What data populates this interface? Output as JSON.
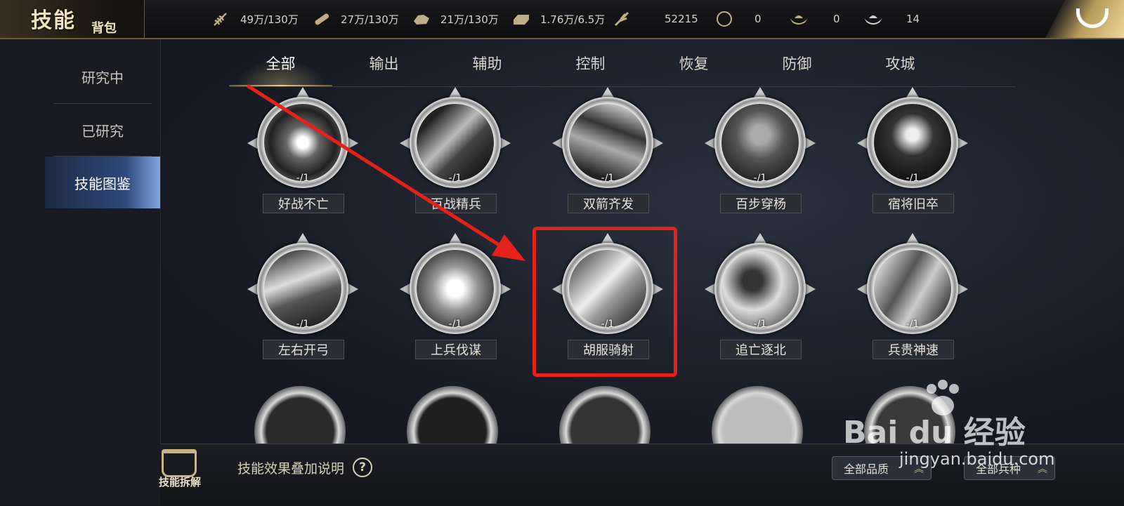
{
  "header": {
    "title_main": "技能",
    "title_sub": "背包",
    "resources": [
      {
        "icon": "wheat-icon",
        "value": "49万/130万"
      },
      {
        "icon": "wood-icon",
        "value": "27万/130万"
      },
      {
        "icon": "stone-icon",
        "value": "21万/130万"
      },
      {
        "icon": "iron-icon",
        "value": "1.76万/6.5万"
      },
      {
        "icon": "feather-icon",
        "value": "52215"
      },
      {
        "icon": "copper-coin-icon",
        "value": "0"
      },
      {
        "icon": "gold-ingot-icon",
        "value": "0"
      },
      {
        "icon": "silver-ingot-icon",
        "value": "14"
      }
    ]
  },
  "sidebar": {
    "items": [
      {
        "label": "研究中"
      },
      {
        "label": "已研究"
      },
      {
        "label": "技能图鉴"
      }
    ],
    "active": "技能图鉴"
  },
  "tabs": [
    "全部",
    "输出",
    "辅助",
    "控制",
    "恢复",
    "防御",
    "攻城"
  ],
  "active_tab": "全部",
  "skills": [
    {
      "name": "好战不亡",
      "count": "-/1"
    },
    {
      "name": "百战精兵",
      "count": "-/1"
    },
    {
      "name": "双箭齐发",
      "count": "-/1"
    },
    {
      "name": "百步穿杨",
      "count": "-/1"
    },
    {
      "name": "宿将旧卒",
      "count": "-/1"
    },
    {
      "name": "左右开弓",
      "count": "-/1"
    },
    {
      "name": "上兵伐谋",
      "count": "-/1"
    },
    {
      "name": "胡服骑射",
      "count": "-/1"
    },
    {
      "name": "追亡逐北",
      "count": "-/1"
    },
    {
      "name": "兵贵神速",
      "count": "-/1"
    }
  ],
  "bottom": {
    "decompose_label": "技能拆解",
    "effect_note": "技能效果叠加说明",
    "help": "?",
    "filter_quality": "全部品质",
    "filter_troop": "全部兵种"
  },
  "watermark": {
    "main": "Bai du 经验",
    "sub": "jingyan.baidu.com"
  },
  "colors": {
    "accent_gold": "#e8cf8a",
    "active_blue": "#2e4a7a",
    "annotation_red": "#e4221b"
  }
}
